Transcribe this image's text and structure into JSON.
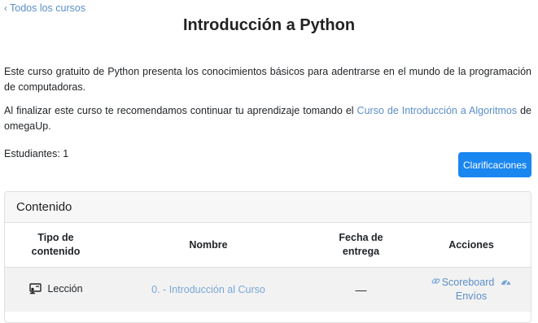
{
  "nav": {
    "back_label": "Todos los cursos"
  },
  "course": {
    "title": "Introducción a Python",
    "description": "Este curso gratuito de Python presenta los conocimientos básicos para adentrarse en el mundo de la programación de computadoras.",
    "recommendation_before": "Al finalizar este curso te recomendamos continuar tu aprendizaje tomando el ",
    "recommendation_link": "Curso de Introducción a Algoritmos",
    "recommendation_after": " de omegaUp.",
    "students_label": "Estudiantes: 1"
  },
  "buttons": {
    "clarifications": "Clarificaciones"
  },
  "content": {
    "header": "Contenido",
    "columns": {
      "type": "Tipo de contenido",
      "name": "Nombre",
      "due_date": "Fecha de entrega",
      "actions": "Acciones"
    },
    "rows": [
      {
        "type": "Lección",
        "name": "0. - Introducción al Curso",
        "due_date": "—",
        "scoreboard": "Scoreboard",
        "submissions": "Envíos"
      }
    ]
  },
  "colors": {
    "primary": "#1a86f0",
    "link": "#5b8fc7"
  },
  "icons": [
    "chevron-left-icon",
    "lesson-icon",
    "link-icon",
    "dashboard-icon"
  ]
}
